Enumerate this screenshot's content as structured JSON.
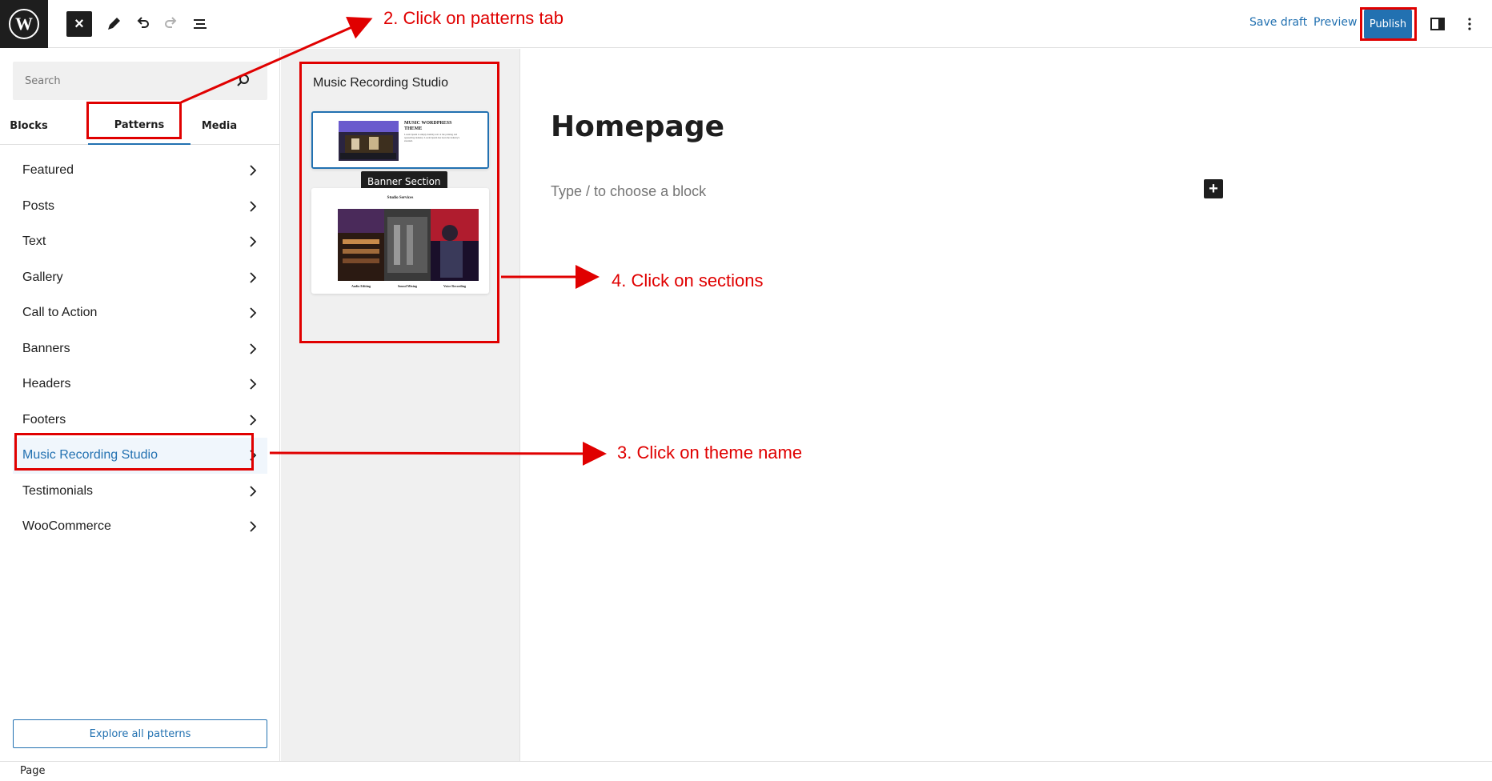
{
  "topbar": {
    "close_icon": "close-icon",
    "save_draft": "Save draft",
    "preview": "Preview",
    "publish": "Publish",
    "accent": "#2271b1"
  },
  "sidebar": {
    "search_placeholder": "Search",
    "tabs": [
      {
        "label": "Blocks"
      },
      {
        "label": "Patterns",
        "active": true
      },
      {
        "label": "Media"
      }
    ],
    "categories": [
      {
        "label": "Featured"
      },
      {
        "label": "Posts"
      },
      {
        "label": "Text"
      },
      {
        "label": "Gallery"
      },
      {
        "label": "Call to Action"
      },
      {
        "label": "Banners"
      },
      {
        "label": "Headers"
      },
      {
        "label": "Footers"
      },
      {
        "label": "Music Recording Studio",
        "selected": true
      },
      {
        "label": "Testimonials"
      },
      {
        "label": "WooCommerce"
      }
    ],
    "explore_button": "Explore all patterns"
  },
  "patterns_panel": {
    "title": "Music Recording Studio",
    "tooltip": "Banner Section",
    "card1": {
      "heading": "MUSIC WORDPRESS THEME",
      "body": "Lorem Ipsum is simply dummy text of the printing and typesetting industry. Lorem Ipsum has been the industry's standard."
    },
    "card2": {
      "heading": "Studio Services",
      "captions": [
        "Audio Editing",
        "Sound Mixing",
        "Voice Recording"
      ]
    }
  },
  "editor": {
    "page_title": "Homepage",
    "block_placeholder": "Type / to choose a block"
  },
  "footer": {
    "breadcrumb": "Page"
  },
  "annotations": {
    "step2": "2. Click on patterns tab",
    "step3": "3. Click on theme name",
    "step4": "4. Click on sections",
    "color": "#e00000"
  }
}
